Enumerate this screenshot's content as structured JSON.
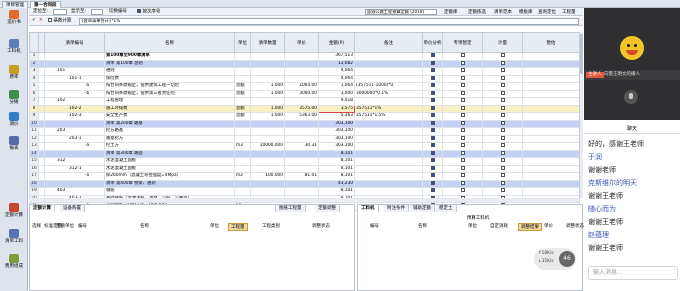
{
  "window": {
    "top_tabs": [
      "项目管理",
      "第一合同段"
    ],
    "top_right": "清单"
  },
  "leftnav": [
    {
      "label": "造价书",
      "color": "#e06b2b"
    },
    {
      "label": "工料机",
      "color": "#5c7fb9"
    },
    {
      "label": "费率",
      "color": "#c8a021"
    },
    {
      "label": "分摊",
      "color": "#3f8f52"
    },
    {
      "label": "调价",
      "color": "#2e7fc8"
    },
    {
      "label": "报表",
      "color": "#536ea8"
    },
    {
      "label": "定额计算",
      "color": "#c6462e"
    },
    {
      "label": "清单工料",
      "color": "#5472b0"
    },
    {
      "label": "费用组成",
      "color": "#7d9c3a"
    }
  ],
  "toolbar1": {
    "locate_label": "定位至:",
    "locate_value": "",
    "display_label": "显示至:",
    "display_value": "",
    "switch_label": "切换编号",
    "seq_label": "按次序号",
    "template_value": "部颁公路工程预算定额 (2018)",
    "buttons": [
      "定额库",
      "定额拣选",
      "清单范本",
      "模板库",
      "查询定位",
      "工程量"
    ]
  },
  "toolbar2": {
    "base_calc": "基数计算",
    "formula": "{各章清单合计}*1%"
  },
  "grid": {
    "headers": [
      "",
      "",
      "清单编号",
      "名称",
      "单位",
      "清单数量",
      "单价",
      "金额(P)",
      "备注",
      "单价分析",
      "专项暂定",
      "计量",
      "暂估"
    ],
    "rows": [
      {
        "n": "1",
        "mark": "",
        "code": "",
        "name": "第100章至900章清单",
        "unit": "",
        "qty": "",
        "price": "",
        "amount": "367,513",
        "remark": "",
        "analysis": true,
        "special": false,
        "measure": false,
        "type": "top"
      },
      {
        "n": "2",
        "mark": "",
        "code": "",
        "name": "清单 第100章 总则",
        "unit": "",
        "qty": "",
        "price": "",
        "amount": "13,082",
        "remark": "",
        "analysis": true,
        "special": false,
        "measure": false,
        "type": "sec"
      },
      {
        "n": "3",
        "mark": "",
        "code": "101",
        "name": "通则",
        "unit": "",
        "qty": "",
        "price": "",
        "amount": "4,064",
        "remark": "",
        "analysis": true,
        "special": false,
        "measure": false,
        "type": ""
      },
      {
        "n": "4",
        "mark": "",
        "code": "101-1",
        "name": "保险费",
        "unit": "",
        "qty": "",
        "price": "",
        "amount": "4,064",
        "remark": "",
        "analysis": true,
        "special": false,
        "measure": false,
        "type": ""
      },
      {
        "n": "5",
        "mark": "",
        "code": "-a",
        "name": "按合同条款规定，提供建筑工程一切险",
        "unit": "总额",
        "qty": "1.000",
        "price": "1064.00",
        "amount": "1,064",
        "remark": "(357511-1000)*0.",
        "analysis": true,
        "special": false,
        "measure": false,
        "type": ""
      },
      {
        "n": "6",
        "mark": "",
        "code": "-b",
        "name": "按合同条款规定，提供第三者责任险",
        "unit": "总额",
        "qty": "1.000",
        "price": "3000.00",
        "amount": "3,000",
        "remark": "3000000*0.1%",
        "analysis": true,
        "special": false,
        "measure": false,
        "type": ""
      },
      {
        "n": "7",
        "mark": "",
        "code": "102",
        "name": "工程管理",
        "unit": "",
        "qty": "",
        "price": "",
        "amount": "9,018",
        "remark": "",
        "analysis": true,
        "special": false,
        "measure": false,
        "type": ""
      },
      {
        "n": "8",
        "mark": "",
        "code": "102-2",
        "name": "施工环保费",
        "unit": "总额",
        "qty": "1.000",
        "price": "3575.00",
        "amount": "3,575",
        "remark": "357511*1%",
        "analysis": true,
        "special": false,
        "measure": false,
        "type": "sel"
      },
      {
        "n": "9",
        "mark": "",
        "code": "102-3",
        "name": "安全生产费",
        "unit": "总额",
        "qty": "1.000",
        "price": "5363.00",
        "amount": "5,363",
        "remark": "357511*1.5%",
        "analysis": true,
        "special": false,
        "measure": false,
        "type": ""
      },
      {
        "n": "10",
        "mark": "",
        "code": "",
        "name": "清单 第200章 路基",
        "unit": "",
        "qty": "",
        "price": "",
        "amount": "303,100",
        "remark": "",
        "analysis": true,
        "special": false,
        "measure": false,
        "type": "sec"
      },
      {
        "n": "11",
        "mark": "",
        "code": "203",
        "name": "挖方路基",
        "unit": "",
        "qty": "",
        "price": "",
        "amount": "303,100",
        "remark": "",
        "analysis": true,
        "special": false,
        "measure": false,
        "type": ""
      },
      {
        "n": "12",
        "mark": "",
        "code": "203-1",
        "name": "路基挖方",
        "unit": "",
        "qty": "",
        "price": "",
        "amount": "303,100",
        "remark": "",
        "analysis": true,
        "special": false,
        "measure": false,
        "type": ""
      },
      {
        "n": "13",
        "mark": "",
        "code": "-a",
        "name": "挖土方",
        "unit": "m3",
        "qty": "10000.000",
        "price": "30.31",
        "amount": "303,100",
        "remark": "",
        "analysis": true,
        "special": false,
        "measure": false,
        "type": ""
      },
      {
        "n": "14",
        "mark": "",
        "code": "",
        "name": "清单 第300章 路面",
        "unit": "",
        "qty": "",
        "price": "",
        "amount": "8,101",
        "remark": "",
        "analysis": true,
        "special": false,
        "measure": false,
        "type": "sec"
      },
      {
        "n": "15",
        "mark": "",
        "code": "312",
        "name": "水泥混凝土面板",
        "unit": "",
        "qty": "",
        "price": "",
        "amount": "8,101",
        "remark": "",
        "analysis": true,
        "special": false,
        "measure": false,
        "type": ""
      },
      {
        "n": "16",
        "mark": "",
        "code": "312-1",
        "name": "水泥混凝土面板",
        "unit": "",
        "qty": "",
        "price": "",
        "amount": "8,101",
        "remark": "",
        "analysis": true,
        "special": false,
        "measure": false,
        "type": ""
      },
      {
        "n": "17",
        "mark": "",
        "code": "-a",
        "name": "厚260mm（混凝土弯拉强度=4Mpa）",
        "unit": "m2",
        "qty": "100.000",
        "price": "81.01",
        "amount": "8,101",
        "remark": "",
        "analysis": true,
        "special": false,
        "measure": false,
        "type": ""
      },
      {
        "n": "18",
        "mark": "",
        "code": "",
        "name": "清单 第400章 桥梁、涵洞",
        "unit": "",
        "qty": "",
        "price": "",
        "amount": "43,230",
        "remark": "",
        "analysis": true,
        "special": false,
        "measure": false,
        "type": "sec"
      },
      {
        "n": "19",
        "mark": "",
        "code": "403",
        "name": "钢筋",
        "unit": "",
        "qty": "",
        "price": "",
        "amount": "8,101",
        "remark": "",
        "analysis": true,
        "special": false,
        "measure": false,
        "type": ""
      },
      {
        "n": "20",
        "mark": "",
        "code": "403-1",
        "name": "基础钢筋（含灌注桩、承台、沉桩、沉井等）",
        "unit": "",
        "qty": "",
        "price": "",
        "amount": "8,101",
        "remark": "",
        "analysis": true,
        "special": false,
        "measure": false,
        "type": ""
      },
      {
        "n": "21",
        "mark": "",
        "code": "-a",
        "name": "光圆钢筋（HPB235、HPB300）",
        "unit": "kg",
        "qty": "",
        "price": "",
        "amount": "",
        "remark": "",
        "analysis": true,
        "special": false,
        "measure": false,
        "type": ""
      }
    ]
  },
  "bottom_left": {
    "tabs": [
      "定额计算",
      "设备购置"
    ],
    "actions": [
      "图纸工程量",
      "定额调整"
    ],
    "headers": [
      "选择",
      "标准定额",
      "定额单位",
      "编号",
      "名称",
      "单位",
      "工程量",
      "工程类别",
      "调整状态"
    ],
    "highlight_col": "工程量"
  },
  "bottom_right": {
    "tabs": [
      "工料机",
      "附注条件",
      "辅助定额",
      "稳定土"
    ],
    "caption": "预算工料机",
    "headers": [
      "编号",
      "名称",
      "单位",
      "自定消耗",
      "调整结果",
      "单价",
      "调整状态"
    ],
    "highlight_col": "调整结果"
  },
  "chat": {
    "header": "聊天",
    "messages": [
      {
        "text": "好的，感谢王老师",
        "color": "#222222"
      },
      {
        "text": "于润",
        "color": "#3a55b4"
      },
      {
        "text": "谢谢老师",
        "color": "#222222"
      },
      {
        "text": "克斯维尔的明天",
        "color": "#3a55b4"
      },
      {
        "text": "谢谢王老师",
        "color": "#222222"
      },
      {
        "text": "随心而为",
        "color": "#3a55b4"
      },
      {
        "text": "谢谢王老师",
        "color": "#222222"
      },
      {
        "text": "赵蕴理",
        "color": "#3a55b4"
      },
      {
        "text": "谢谢王老师",
        "color": "#222222"
      }
    ],
    "input_placeholder": "输入消息...",
    "speaker_tag": "主讲人",
    "speaker_name": "向量王明文的播人",
    "net_up": "↑18K/s",
    "net_down": "↓35K/s",
    "badge": "46"
  }
}
